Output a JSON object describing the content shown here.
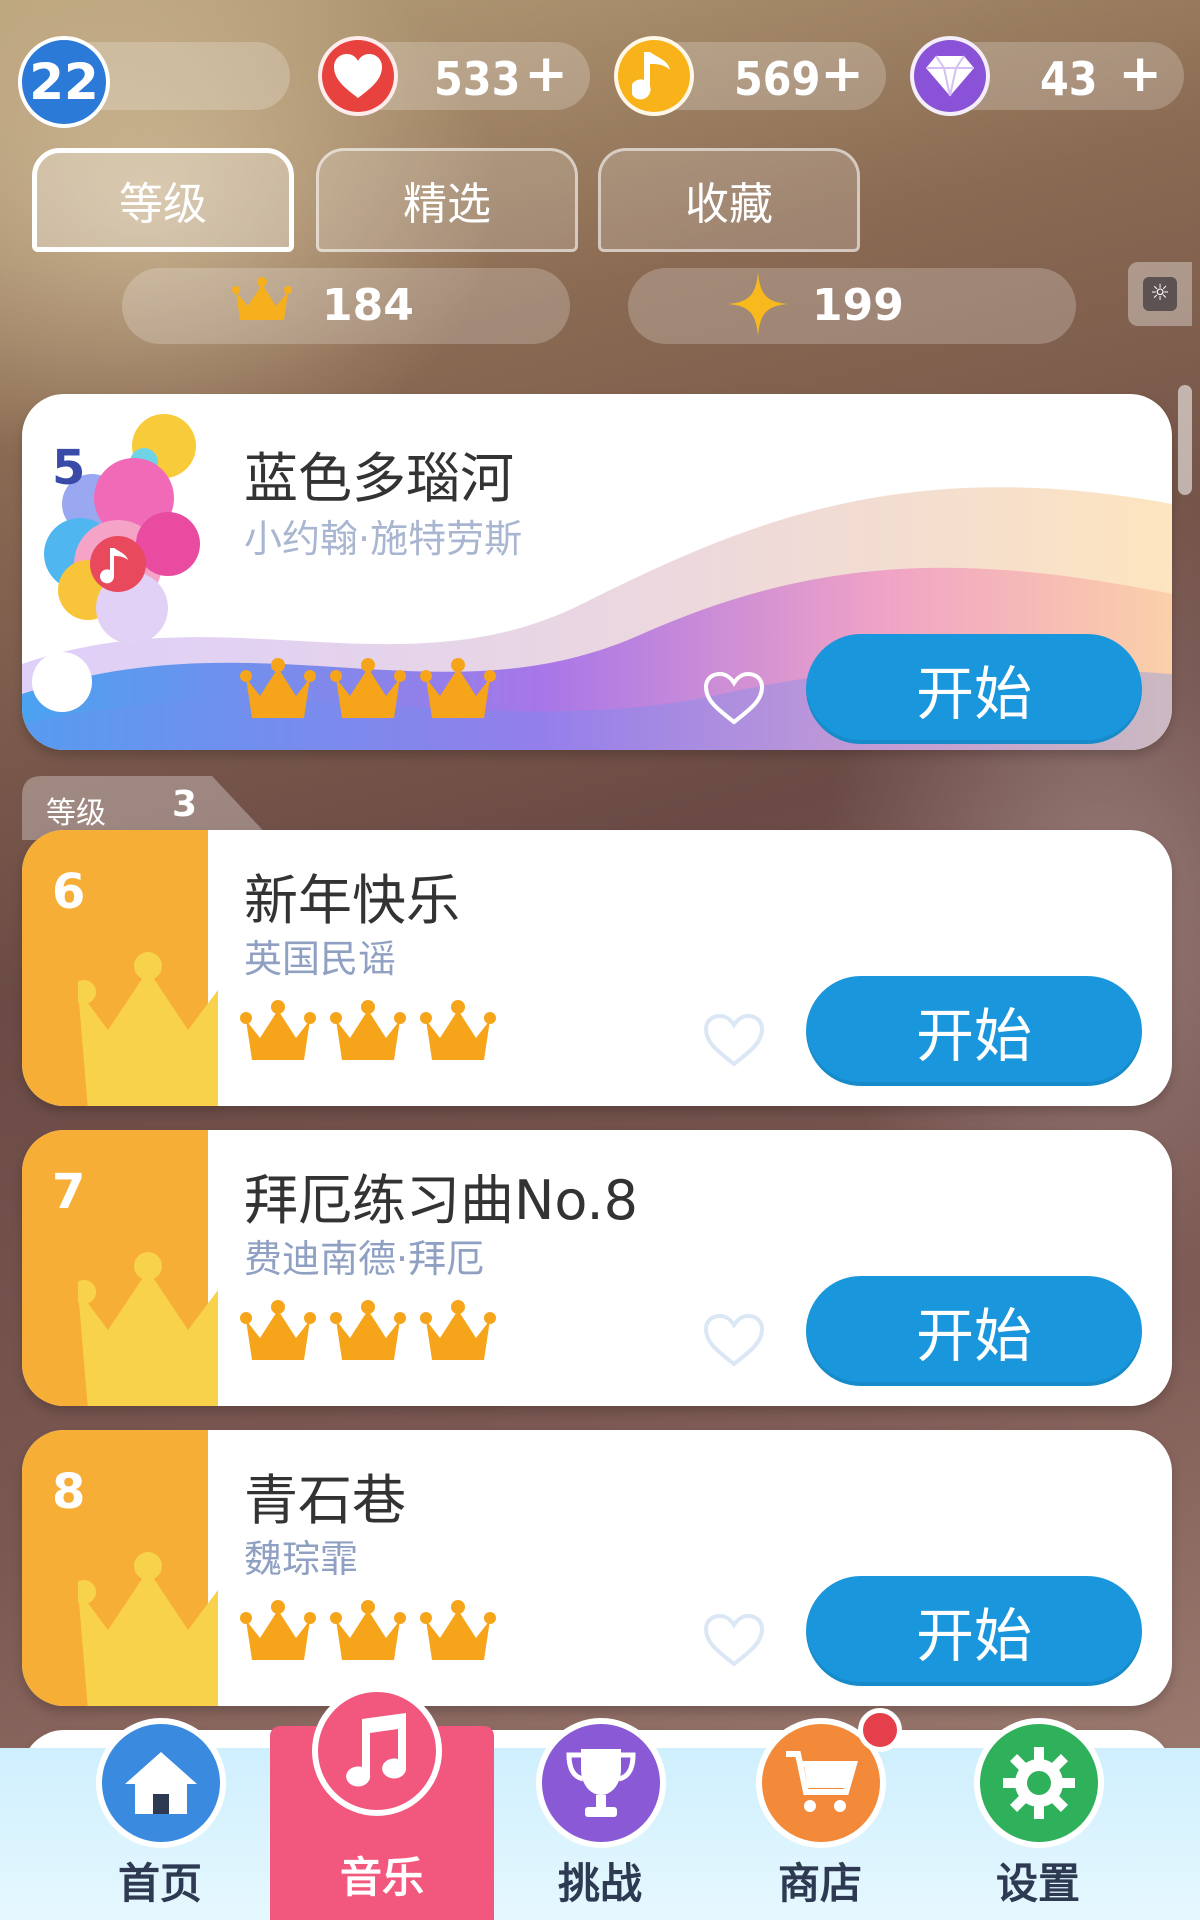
{
  "status": {
    "level": "22",
    "hearts": {
      "value": "533",
      "plus": "+"
    },
    "notes": {
      "value": "569",
      "plus": "+"
    },
    "gems": {
      "value": "43",
      "plus": "+"
    }
  },
  "tabs": [
    {
      "label": "等级",
      "active": true
    },
    {
      "label": "精选",
      "active": false
    },
    {
      "label": "收藏",
      "active": false
    }
  ],
  "stats": {
    "crowns": "184",
    "stars": "199"
  },
  "featured_song": {
    "number": "5",
    "title": "蓝色多瑙河",
    "artist": "小约翰·施特劳斯",
    "crowns": 3,
    "start_label": "开始"
  },
  "grade_tag": {
    "label": "等级",
    "value": "3"
  },
  "songs": [
    {
      "number": "6",
      "title": "新年快乐",
      "artist": "英国民谣",
      "crowns": 3,
      "start_label": "开始"
    },
    {
      "number": "7",
      "title": "拜厄练习曲No.8",
      "artist": "费迪南德·拜厄",
      "crowns": 3,
      "start_label": "开始"
    },
    {
      "number": "8",
      "title": "青石巷",
      "artist": "魏琮霏",
      "crowns": 3,
      "start_label": "开始"
    }
  ],
  "bottom_nav": [
    {
      "label": "首页",
      "icon": "home-icon",
      "color": "#3a8be0"
    },
    {
      "label": "音乐",
      "icon": "music-note-icon",
      "color": "#f2577d",
      "active": true
    },
    {
      "label": "挑战",
      "icon": "trophy-icon",
      "color": "#8a5ad6"
    },
    {
      "label": "商店",
      "icon": "cart-icon",
      "color": "#f28a3a",
      "badge": true
    },
    {
      "label": "设置",
      "icon": "gear-icon",
      "color": "#2fb05a"
    }
  ],
  "colors": {
    "start_button": "#1a97dc",
    "crown": "#f6a51b",
    "side_panel": "#f6ae36",
    "heart": "#e8423e",
    "note_coin": "#f8b31a",
    "gem": "#8a52d6",
    "level": "#2b7ad8"
  }
}
